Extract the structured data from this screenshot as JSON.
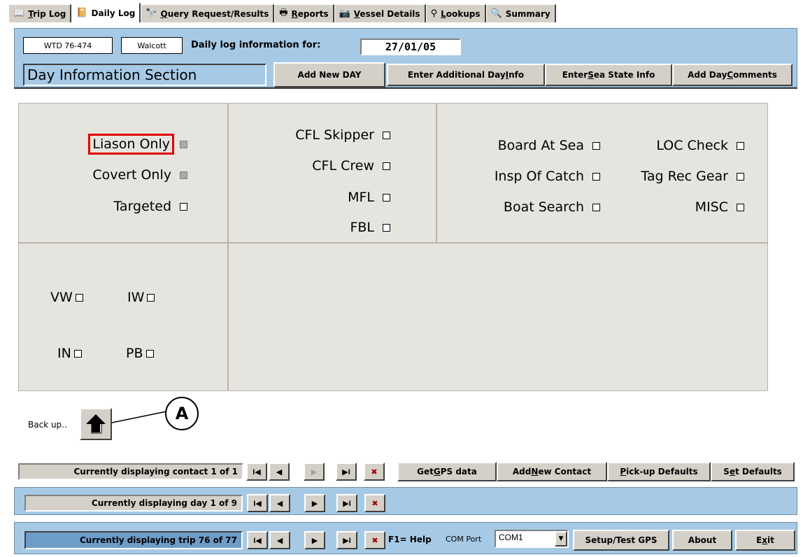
{
  "tabs": [
    {
      "label": "Trip Log",
      "icon": "book-icon",
      "glyph": "📖",
      "ul": "T",
      "rest": "rip Log"
    },
    {
      "label": "Daily Log",
      "icon": "calendar-book-icon",
      "glyph": "📔",
      "ul": "",
      "rest": "Daily Log"
    },
    {
      "label": "Query Request/Results",
      "icon": "binoculars-icon",
      "glyph": "🔭",
      "ul": "Q",
      "rest": "uery Request/Results"
    },
    {
      "label": "Reports",
      "icon": "printer-icon",
      "glyph": "🖶",
      "ul": "R",
      "rest": "eports"
    },
    {
      "label": "Vessel Details",
      "icon": "camera-icon",
      "glyph": "📷",
      "ul": "V",
      "rest": "essel Details"
    },
    {
      "label": "Lookups",
      "icon": "magnifier-icon",
      "glyph": "⚲",
      "ul": "L",
      "rest": "ookups"
    },
    {
      "label": "Summary",
      "icon": "summary-icon",
      "glyph": "🔍",
      "ul": "",
      "rest": "Summary"
    }
  ],
  "header": {
    "vessel_id": "WTD 76-474",
    "vessel_name": "Walcott",
    "daily_log_label": "Daily log information for:",
    "date": "27/01/05",
    "section_title": "Day Information Section",
    "add_new_day": "Add New DAY",
    "enter_additional_pre": "Enter Additional Day ",
    "enter_additional_ul": "I",
    "enter_additional_post": "nfo",
    "enter_sea_pre": "Enter ",
    "enter_sea_ul": "S",
    "enter_sea_post": "ea State Info",
    "add_comments_pre": "Add Day ",
    "add_comments_ul": "C",
    "add_comments_post": "omments"
  },
  "checks_left": [
    {
      "label": "Liason Only",
      "style": "grey"
    },
    {
      "label": "Covert Only",
      "style": "grey"
    },
    {
      "label": "Targeted",
      "style": "white"
    }
  ],
  "checks_mid": [
    "CFL Skipper",
    "CFL Crew",
    "MFL",
    "FBL"
  ],
  "checks_right_a": [
    "Board At Sea",
    "Insp Of Catch",
    "Boat Search"
  ],
  "checks_right_b": [
    "LOC Check",
    "Tag Rec Gear",
    "MISC"
  ],
  "checks_lower": {
    "vw": "VW",
    "iw": "IW",
    "in": "IN",
    "pb": "PB"
  },
  "backup_label": "Back up..",
  "callout_letter": "A",
  "contact_bar": {
    "label": "Currently displaying contact 1 of 1",
    "gps_pre": "Get ",
    "gps_ul": "G",
    "gps_post": "PS data",
    "add_pre": "Add ",
    "add_ul": "N",
    "add_post": "ew Contact",
    "pick_pre": "",
    "pick_ul": "P",
    "pick_post": "ick-up Defaults",
    "set_pre": "S",
    "set_ul": "e",
    "set_post": "t Defaults"
  },
  "day_bar": {
    "label": "Currently displaying day 1 of 9"
  },
  "trip_bar": {
    "label": "Currently displaying trip 76 of 77",
    "help": "F1= Help",
    "com_label": "COM Port",
    "com_value": "COM1",
    "setup": "Setup/Test GPS",
    "about": "About",
    "exit_pre": "E",
    "exit_ul": "x",
    "exit_post": "it"
  },
  "nav_glyphs": {
    "first": "I◀",
    "prev": "◀",
    "next": "▶",
    "last": "▶I",
    "del": "✖"
  },
  "colors": {
    "panel": "#a6cae6",
    "button": "#d4d0c8",
    "highlight": "#e00000",
    "grid": "#e6e4de"
  }
}
